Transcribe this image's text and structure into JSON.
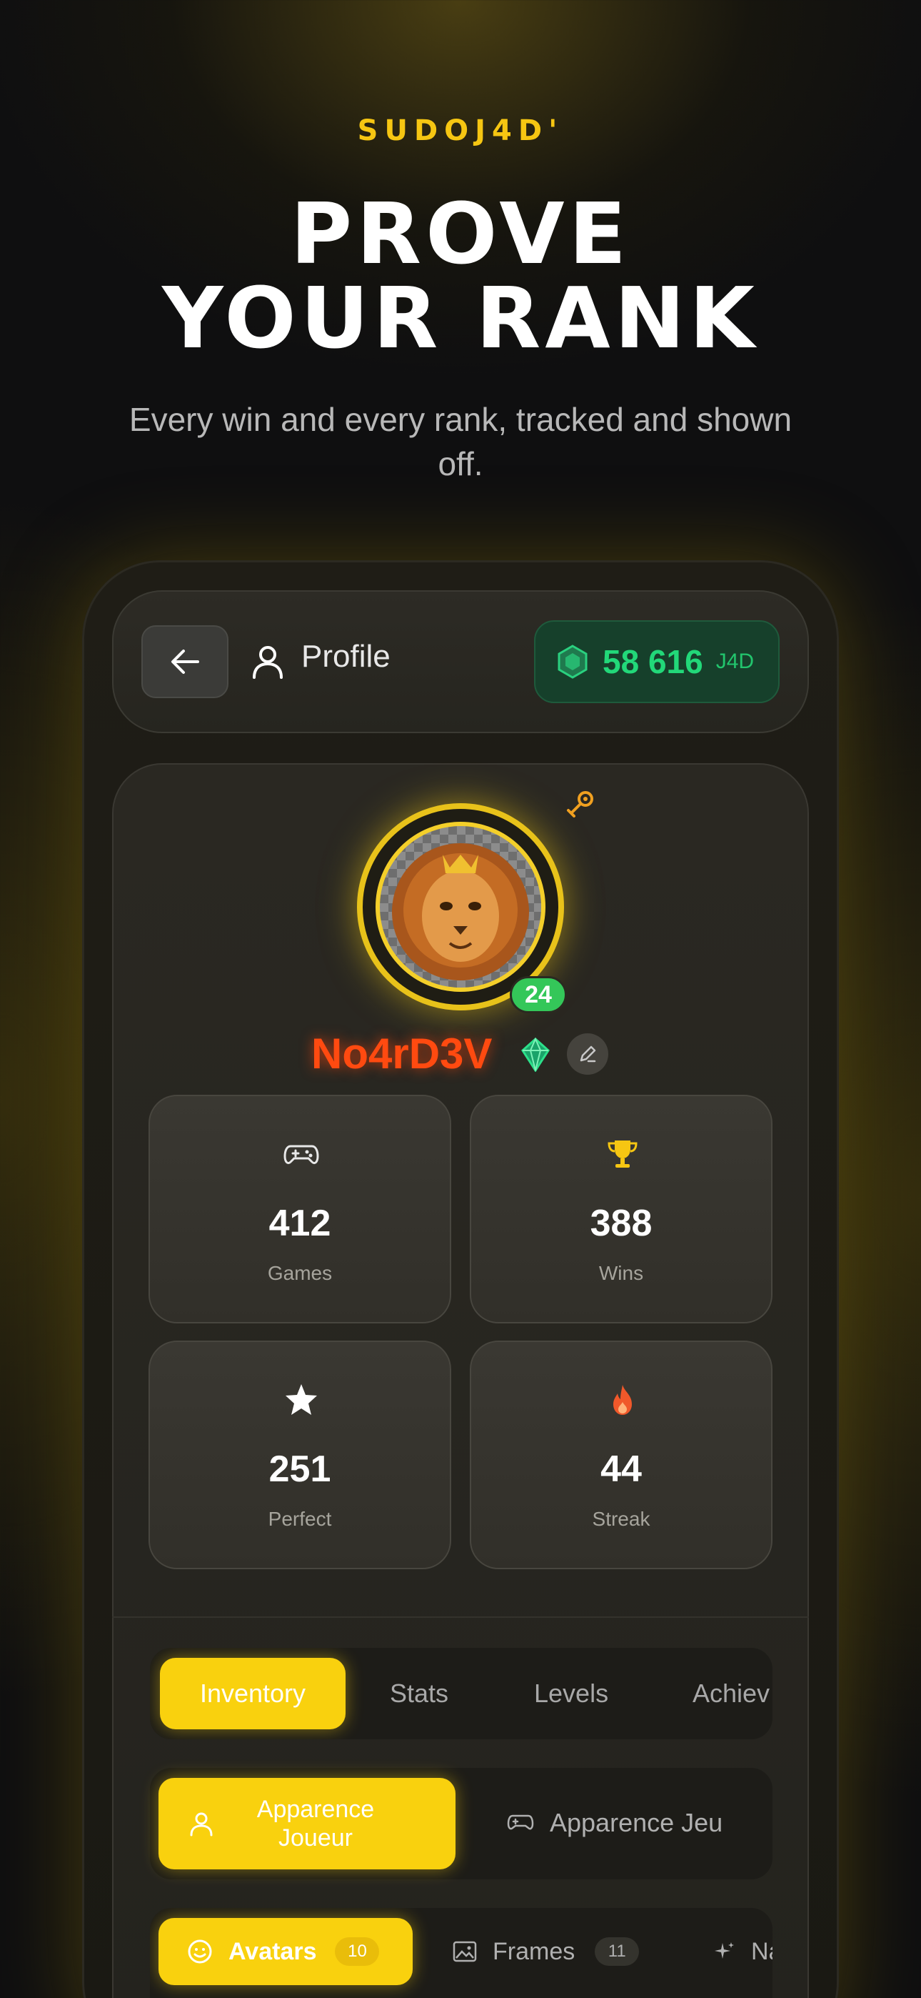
{
  "brand": {
    "name": "SUDOJ4D'"
  },
  "hero": {
    "title_line1": "PROVE",
    "title_line2": "YOUR RANK",
    "subtitle": "Every win and every rank, tracked and shown off."
  },
  "header": {
    "back_icon": "arrow-left-icon",
    "title_icon": "user-icon",
    "title": "Profile",
    "balance": {
      "icon": "green-gem-icon",
      "amount": "58 616",
      "unit": "J4D"
    }
  },
  "profile": {
    "avatar": "lion-avatar",
    "level": "24",
    "username": "No4rD3V",
    "badge_icon": "diamond-icon",
    "edit_icon": "pencil-icon",
    "pin_icon": "pin-icon"
  },
  "stats": [
    {
      "icon": "gamepad-icon",
      "value": "412",
      "label": "Games"
    },
    {
      "icon": "trophy-icon",
      "value": "388",
      "label": "Wins"
    },
    {
      "icon": "star-icon",
      "value": "251",
      "label": "Perfect"
    },
    {
      "icon": "flame-icon",
      "value": "44",
      "label": "Streak"
    }
  ],
  "tabs": [
    "Inventory",
    "Stats",
    "Levels",
    "Achiev"
  ],
  "subtabs": {
    "active": {
      "icon": "user-icon",
      "line1": "Apparence",
      "line2": "Joueur"
    },
    "inactive": {
      "icon": "gamepad-icon",
      "label": "Apparence Jeu"
    }
  },
  "filters": [
    {
      "icon": "smiley-icon",
      "label": "Avatars",
      "count": "10"
    },
    {
      "icon": "image-icon",
      "label": "Frames",
      "count": "11"
    },
    {
      "icon": "sparkle-icon",
      "label": "Na"
    }
  ],
  "colors": {
    "accent": "#f9d10e",
    "brand": "#f6c612",
    "username": "#ff4a10",
    "currency": "#22d879",
    "level_badge": "#34c759"
  }
}
